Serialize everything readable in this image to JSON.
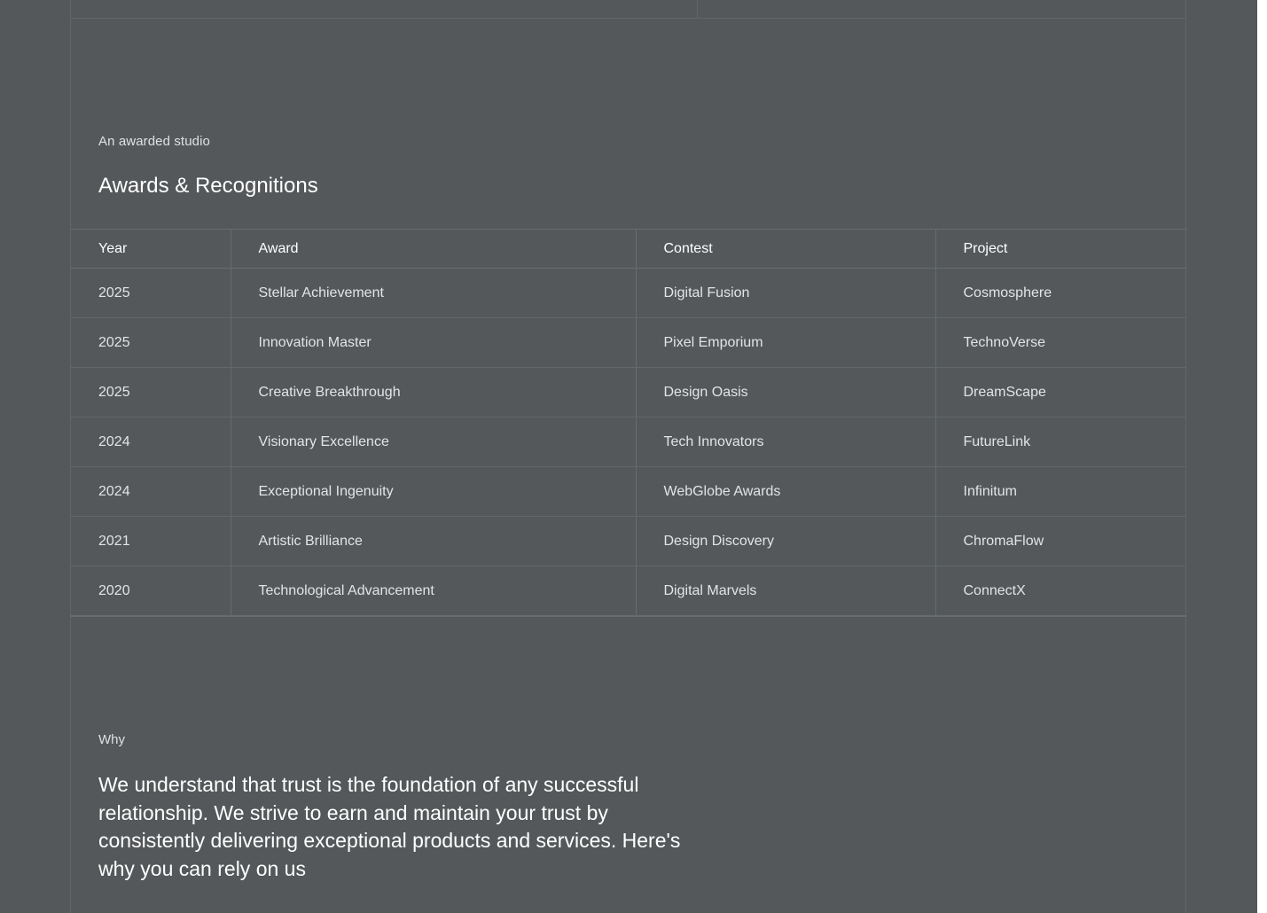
{
  "colors": {
    "background": "#54585a",
    "rule": "#676c6f",
    "text_primary": "#ffffff",
    "text_secondary": "#e2e4e5"
  },
  "awards": {
    "eyebrow": "An awarded studio",
    "title": "Awards & Recognitions",
    "columns": [
      "Year",
      "Award",
      "Contest",
      "Project"
    ],
    "rows": [
      {
        "year": "2025",
        "award": "Stellar Achievement",
        "contest": "Digital Fusion",
        "project": "Cosmosphere"
      },
      {
        "year": "2025",
        "award": "Innovation Master",
        "contest": "Pixel Emporium",
        "project": "TechnoVerse"
      },
      {
        "year": "2025",
        "award": "Creative Breakthrough",
        "contest": "Design Oasis",
        "project": "DreamScape"
      },
      {
        "year": "2024",
        "award": "Visionary Excellence",
        "contest": "Tech Innovators",
        "project": "FutureLink"
      },
      {
        "year": "2024",
        "award": "Exceptional Ingenuity",
        "contest": "WebGlobe Awards",
        "project": "Infinitum"
      },
      {
        "year": "2021",
        "award": "Artistic Brilliance",
        "contest": "Design Discovery",
        "project": "ChromaFlow"
      },
      {
        "year": "2020",
        "award": "Technological Advancement",
        "contest": "Digital Marvels",
        "project": "ConnectX"
      }
    ]
  },
  "why": {
    "eyebrow": "Why",
    "text": "We understand that trust is the foundation of any successful relationship. We strive to earn and maintain your trust by consistently delivering exceptional products and services. Here's why you can rely on us"
  }
}
